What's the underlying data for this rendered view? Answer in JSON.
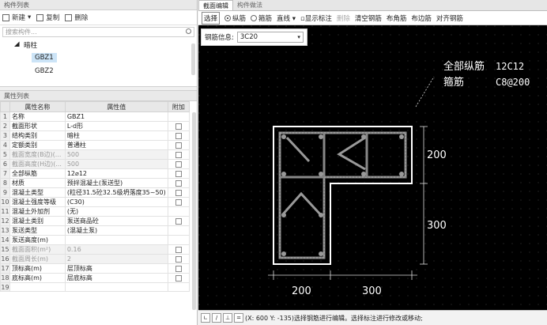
{
  "component_list": {
    "header": "构件列表",
    "toolbar": {
      "new_label": "新建",
      "copy_label": "复制",
      "delete_label": "删除"
    },
    "search_placeholder": "搜索构件...",
    "tree": {
      "parent": "暗柱",
      "items": [
        "GBZ1",
        "GBZ2"
      ],
      "selected": "GBZ1"
    }
  },
  "property_list": {
    "header": "属性列表",
    "columns": [
      "属性名称",
      "属性值",
      "附加"
    ],
    "rows": [
      {
        "num": "1",
        "name": "名称",
        "value": "GBZ1",
        "checkbox": false,
        "gray": false
      },
      {
        "num": "2",
        "name": "截面形状",
        "value": "L-d形",
        "checkbox": true,
        "gray": false
      },
      {
        "num": "3",
        "name": "结构类别",
        "value": "暗柱",
        "checkbox": true,
        "gray": false
      },
      {
        "num": "4",
        "name": "定额类别",
        "value": "普通柱",
        "checkbox": true,
        "gray": false
      },
      {
        "num": "5",
        "name": "截面宽度(B边)(...",
        "value": "500",
        "checkbox": true,
        "gray": true
      },
      {
        "num": "6",
        "name": "截面高度(H边)(...",
        "value": "500",
        "checkbox": true,
        "gray": true
      },
      {
        "num": "7",
        "name": "全部纵筋",
        "value": "12⌀12",
        "checkbox": true,
        "gray": false
      },
      {
        "num": "8",
        "name": "材质",
        "value": "预拌混凝土(泵送型)",
        "checkbox": true,
        "gray": false
      },
      {
        "num": "9",
        "name": "混凝土类型",
        "value": "(粒径31.5砼32.5级坍落度35~50)",
        "checkbox": true,
        "gray": false
      },
      {
        "num": "10",
        "name": "混凝土强度等级",
        "value": "(C30)",
        "checkbox": true,
        "gray": false
      },
      {
        "num": "11",
        "name": "混凝土外加剂",
        "value": "(无)",
        "checkbox": false,
        "gray": false
      },
      {
        "num": "12",
        "name": "混凝土类别",
        "value": "泵送商品砼",
        "checkbox": true,
        "gray": false
      },
      {
        "num": "13",
        "name": "泵送类型",
        "value": "(混凝土泵)",
        "checkbox": false,
        "gray": false
      },
      {
        "num": "14",
        "name": "泵送高度(m)",
        "value": "",
        "checkbox": false,
        "gray": false
      },
      {
        "num": "15",
        "name": "截面面积(m²)",
        "value": "0.16",
        "checkbox": true,
        "gray": true
      },
      {
        "num": "16",
        "name": "截面周长(m)",
        "value": "2",
        "checkbox": true,
        "gray": true
      },
      {
        "num": "17",
        "name": "顶标高(m)",
        "value": "层顶标高",
        "checkbox": true,
        "gray": false
      },
      {
        "num": "18",
        "name": "底标高(m)",
        "value": "层底标高",
        "checkbox": true,
        "gray": false
      },
      {
        "num": "19",
        "name": "",
        "value": "",
        "checkbox": false,
        "gray": false
      }
    ]
  },
  "editor": {
    "tabs": [
      "截面编辑",
      "构件做法"
    ],
    "toolbar": {
      "select": "选择",
      "radio_longitudinal": "纵筋",
      "radio_stirrup": "箍筋",
      "line_mode": "直线",
      "show_label": "显示标注",
      "delete": "删除",
      "clear_rebar": "清空钢筋",
      "corner_rebar": "布角筋",
      "edge_rebar": "布边筋",
      "symmetric_rebar": "对齐钢筋"
    },
    "rebar_info_label": "钢筋信息:",
    "rebar_info_value": "3C20",
    "annotation": {
      "label1": "全部纵筋",
      "value1": "12C12",
      "label2": "箍筋",
      "value2": "C8@200"
    },
    "dimensions": {
      "right_top": "200",
      "right_bottom": "300",
      "bottom_left": "200",
      "bottom_right": "300"
    },
    "status_text": "(X: 600 Y: -135)选择钢筋进行编辑。选择标注进行修改或移动;"
  }
}
